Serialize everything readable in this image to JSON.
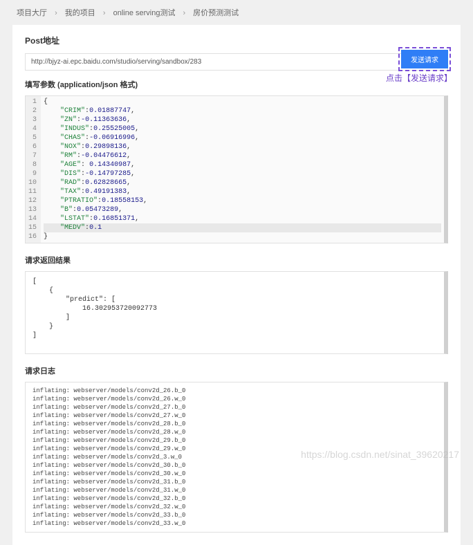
{
  "breadcrumb": {
    "items": [
      "项目大厅",
      "我的项目",
      "online serving测试",
      "房价预测测试"
    ]
  },
  "post": {
    "title": "Post地址",
    "url": "http://bjyz-ai.epc.baidu.com/studio/serving/sandbox/283",
    "send_label": "发送请求",
    "annotation": "点击【发送请求】"
  },
  "params": {
    "title": "填写参数 (application/json 格式)",
    "editor_lines": [
      "{",
      "    \"CRIM\":0.01887747,",
      "    \"ZN\":-0.11363636,",
      "    \"INDUS\":0.25525005,",
      "    \"CHAS\":-0.06916996,",
      "    \"NOX\":0.29898136,",
      "    \"RM\":-0.04476612,",
      "    \"AGE\": 0.14340987,",
      "    \"DIS\":-0.14797285,",
      "    \"RAD\":0.62828665,",
      "    \"TAX\":0.49191383,",
      "    \"PTRATIO\":0.18558153,",
      "    \"B\":0.05473289,",
      "    \"LSTAT\":0.16851371,",
      "    \"MEDV\":0.1",
      "}"
    ]
  },
  "result": {
    "title": "请求返回结果",
    "body": "[\n    {\n        \"predict\": [\n            16.302953720092773\n        ]\n    }\n]"
  },
  "logs": {
    "title": "请求日志",
    "lines": [
      "inflating: webserver/models/conv2d_26.b_0",
      "inflating: webserver/models/conv2d_26.w_0",
      "inflating: webserver/models/conv2d_27.b_0",
      "inflating: webserver/models/conv2d_27.w_0",
      "inflating: webserver/models/conv2d_28.b_0",
      "inflating: webserver/models/conv2d_28.w_0",
      "inflating: webserver/models/conv2d_29.b_0",
      "inflating: webserver/models/conv2d_29.w_0",
      "inflating: webserver/models/conv2d_3.w_0",
      "inflating: webserver/models/conv2d_30.b_0",
      "inflating: webserver/models/conv2d_30.w_0",
      "inflating: webserver/models/conv2d_31.b_0",
      "inflating: webserver/models/conv2d_31.w_0",
      "inflating: webserver/models/conv2d_32.b_0",
      "inflating: webserver/models/conv2d_32.w_0",
      "inflating: webserver/models/conv2d_33.b_0",
      "inflating: webserver/models/conv2d_33.w_0"
    ]
  },
  "watermark": "https://blog.csdn.net/sinat_39620217"
}
